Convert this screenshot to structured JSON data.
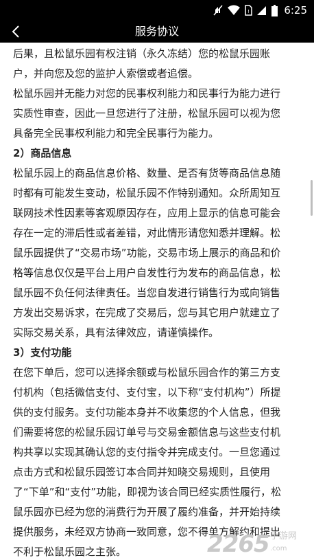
{
  "status_bar": {
    "time": "6:25",
    "icons": [
      "mute-icon",
      "wifi-icon",
      "sim-icon",
      "signal-icon",
      "battery-icon"
    ]
  },
  "toolbar": {
    "title": "服务协议",
    "back_icon": "chevron-left-icon"
  },
  "content": {
    "lines": [
      {
        "text": "后果，且松鼠乐园有权注销（永久冻结）您的松鼠乐园账",
        "bold": false
      },
      {
        "text": "户，并向您及您的监护人索偿或者追偿。",
        "bold": false
      },
      {
        "text": "松鼠乐园并无能力对您的民事权利能力和民事行为能力进行",
        "bold": false
      },
      {
        "text": "实质性审查，因此一旦您进行了注册，松鼠乐园可以视为您",
        "bold": false
      },
      {
        "text": "具备完全民事权利能力和完全民事行为能力。",
        "bold": false
      },
      {
        "text": "2）商品信息",
        "bold": true
      },
      {
        "text": "松鼠乐园上的商品信息价格、数量、是否有货等商品信息随",
        "bold": false
      },
      {
        "text": "时都有可能发生变动，松鼠乐园不作特别通知。众所周知互",
        "bold": false
      },
      {
        "text": "联网技术性因素等客观原因存在，应用上显示的信息可能会",
        "bold": false
      },
      {
        "text": "存在一定的滞后性或者差错，对此情形请您知悉并理解。松",
        "bold": false
      },
      {
        "text": "鼠乐园提供了“交易市场”功能，交易市场上展示的商品和价",
        "bold": false
      },
      {
        "text": "格等信息仅仅是平台上用户自发性行为发布的商品信息，松",
        "bold": false
      },
      {
        "text": "鼠乐园不负任何法律责任。当您自发进行销售行为或向销售",
        "bold": false
      },
      {
        "text": "方发出交易诉求，在完成了交易后，您与其它用户就建立了",
        "bold": false
      },
      {
        "text": "实际交易关系，具有法律效应，请谨慎操作。",
        "bold": false
      },
      {
        "text": "3）支付功能",
        "bold": true
      },
      {
        "text": "在您下单后，您可以选择余额或与松鼠乐园合作的第三方支",
        "bold": false
      },
      {
        "text": "付机构（包括微信支付、支付宝，以下称“支付机构”）所提",
        "bold": false
      },
      {
        "text": "供的支付服务。支付功能本身并不收集您的个人信息，但我",
        "bold": false
      },
      {
        "text": "们需要将您的松鼠乐园订单号与交易金额信息与这些支付机",
        "bold": false
      },
      {
        "text": "构共享以实现其确认您的支付指令并完成支付。一旦您通过",
        "bold": false
      },
      {
        "text": "点击方式和松鼠乐园签订本合同并知晓交易规则，且使用",
        "bold": false
      },
      {
        "text": "了“下单”和“支付”功能，即视为该合同已经实质性履行，松",
        "bold": false
      },
      {
        "text": "鼠乐园亦已经为您的消费行为开展了履约准备，并开始持续",
        "bold": false
      },
      {
        "text": "提供服务，未经双方协商一致同意，您不得单方解约和提出",
        "bold": false
      },
      {
        "text": "不利于松鼠乐园之主张。",
        "bold": false
      }
    ]
  },
  "watermark": {
    "number": "2265",
    "site": "手游网",
    "domain": ".com"
  }
}
